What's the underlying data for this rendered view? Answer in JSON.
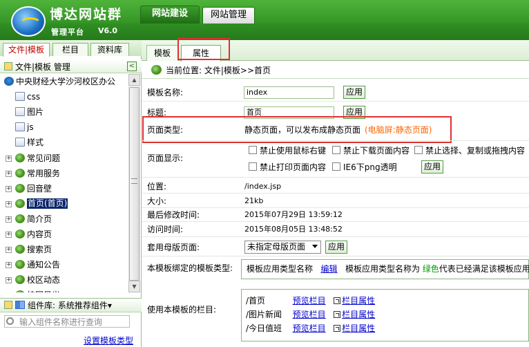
{
  "header": {
    "brand": "博达网站群",
    "platform": "管理平台",
    "version": "V6.0",
    "tabs": [
      "网站建设",
      "网站管理"
    ]
  },
  "left": {
    "tabs": [
      "文件|模板",
      "栏目",
      "资料库"
    ],
    "header": "文件|模板 管理",
    "collapse": "<",
    "tree": [
      {
        "label": "中央财经大学沙河校区办公",
        "icon": "globe-icon",
        "level": 0,
        "plus": ""
      },
      {
        "label": "css",
        "icon": "folder-icon",
        "level": 1,
        "plus": ""
      },
      {
        "label": "图片",
        "icon": "folder-icon",
        "level": 1,
        "plus": ""
      },
      {
        "label": "js",
        "icon": "folder-icon",
        "level": 1,
        "plus": ""
      },
      {
        "label": "样式",
        "icon": "folder-icon",
        "level": 1,
        "plus": ""
      },
      {
        "label": "常见问题",
        "icon": "page-icon",
        "level": 1,
        "plus": "+"
      },
      {
        "label": "常用服务",
        "icon": "page-icon",
        "level": 1,
        "plus": "+"
      },
      {
        "label": "回音壁",
        "icon": "page-icon",
        "level": 1,
        "plus": "+"
      },
      {
        "label": "首页(首页)",
        "icon": "page-icon",
        "level": 1,
        "plus": "+",
        "selected": true
      },
      {
        "label": "简介页",
        "icon": "page-icon",
        "level": 1,
        "plus": "+"
      },
      {
        "label": "内容页",
        "icon": "page-icon",
        "level": 1,
        "plus": "+"
      },
      {
        "label": "搜索页",
        "icon": "page-icon",
        "level": 1,
        "plus": "+"
      },
      {
        "label": "通知公告",
        "icon": "page-icon",
        "level": 1,
        "plus": "+"
      },
      {
        "label": "校区动态",
        "icon": "page-icon",
        "level": 1,
        "plus": "+"
      },
      {
        "label": "校园风光",
        "icon": "page-icon",
        "level": 1,
        "plus": "+"
      }
    ],
    "component_lib": "组件库: 系统推荐组件▾",
    "search_placeholder": "输入组件名称进行查询",
    "set_type": "设置模板类型"
  },
  "right": {
    "tabs": [
      "模板",
      "属性"
    ],
    "breadcrumb": "当前位置: 文件|模板>>首页",
    "fields": {
      "name_label": "模板名称:",
      "name_value": "index",
      "title_label": "标题:",
      "title_value": "首页",
      "type_label": "页面类型:",
      "type_value": "静态页面，可以发布成静态页面",
      "type_note": "(电脑屏:静态页面)",
      "display_label": "页面显示:",
      "opt1": "禁止使用鼠标右键",
      "opt2": "禁止下载页面内容",
      "opt3": "禁止选择、复制或拖拽内容",
      "opt4": "禁止打印页面内容",
      "opt5": "IE6下png透明",
      "pos_label": "位置:",
      "pos_value": "/index.jsp",
      "size_label": "大小:",
      "size_value": "21kb",
      "mod_label": "最后修改时间:",
      "mod_value": "2015年07月29日 13:59:12",
      "visit_label": "访问时间:",
      "visit_value": "2015年08月05日 13:48:52",
      "master_label": "套用母版页面:",
      "master_value": "未指定母版页面",
      "bind_label": "本模板绑定的模板类型:",
      "bind_text1": "模板应用类型名称",
      "bind_edit": "编辑",
      "bind_text2": "模板应用类型名称为",
      "bind_green": "绿色",
      "bind_text3": "代表已经满足该模板应用",
      "cols_label": "使用本模板的栏目:"
    },
    "apply": "应用",
    "columns": [
      {
        "path": "/首页",
        "preview": "预览栏目",
        "prop": "栏目属性"
      },
      {
        "path": "/图片新闻",
        "preview": "预览栏目",
        "prop": "栏目属性"
      },
      {
        "path": "/今日值班",
        "preview": "预览栏目",
        "prop": "栏目属性"
      }
    ]
  },
  "colors": {
    "header_green": "#2f8f22",
    "highlight_red": "#e03030",
    "link_blue": "#0000cc",
    "note_orange": "#ff6600"
  }
}
